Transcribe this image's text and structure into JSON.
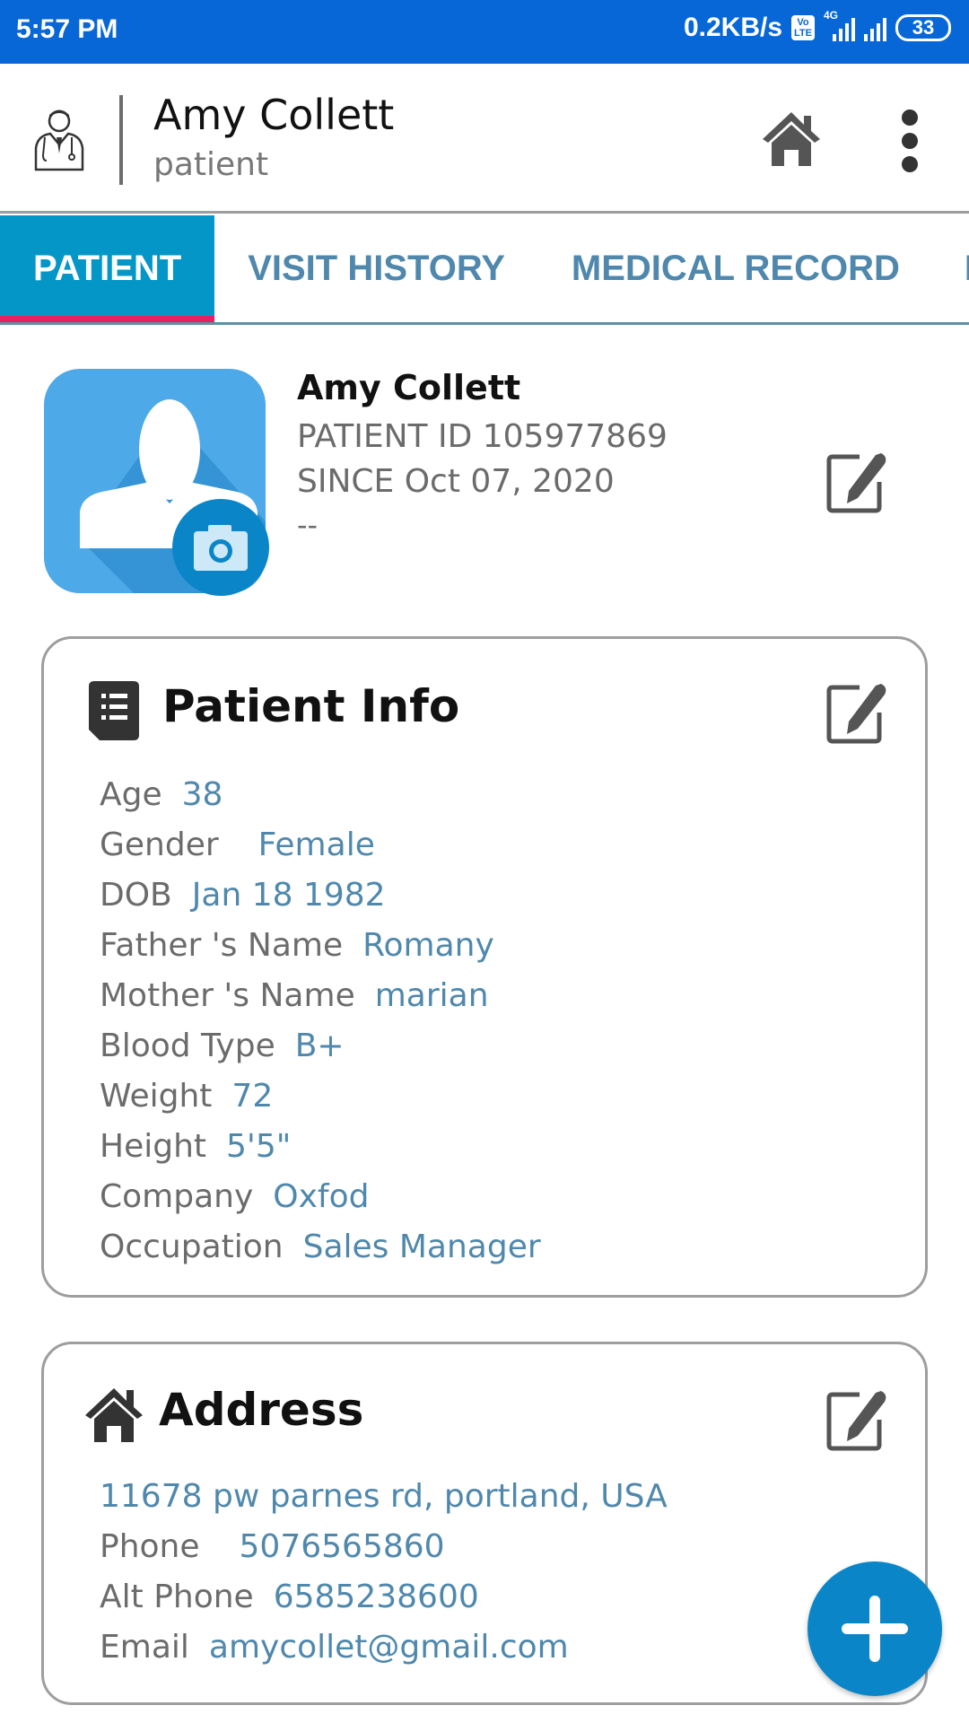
{
  "status_bar": {
    "time": "5:57 PM",
    "net_speed": "0.2KB/s",
    "volte_top": "Vo",
    "volte_bottom": "LTE",
    "network_type": "4G",
    "battery": "33"
  },
  "header": {
    "title": "Amy Collett",
    "subtitle": "patient",
    "icons": [
      "doctor-icon",
      "home-icon",
      "more-vert-icon"
    ]
  },
  "tabs": [
    {
      "label": "PATIENT",
      "active": true
    },
    {
      "label": "VISIT HISTORY",
      "active": false
    },
    {
      "label": "MEDICAL RECORD",
      "active": false
    },
    {
      "label": "M",
      "active": false
    }
  ],
  "profile": {
    "name": "Amy Collett",
    "patient_id": "PATIENT ID 105977869",
    "since": "SINCE Oct 07, 2020",
    "extra": "--"
  },
  "patient_info": {
    "title": "Patient Info",
    "fields": [
      {
        "label": "Age",
        "value": "38"
      },
      {
        "label": "Gender",
        "value": "Female"
      },
      {
        "label": "DOB",
        "value": "Jan 18 1982"
      },
      {
        "label": "Father 's Name",
        "value": "Romany"
      },
      {
        "label": "Mother 's Name",
        "value": "marian"
      },
      {
        "label": "Blood Type",
        "value": "B+"
      },
      {
        "label": "Weight",
        "value": "72"
      },
      {
        "label": "Height",
        "value": "5'5\""
      },
      {
        "label": "Company",
        "value": "Oxfod"
      },
      {
        "label": "Occupation",
        "value": "Sales Manager"
      }
    ]
  },
  "address": {
    "title": "Address",
    "line": "11678 pw parnes rd, portland, USA",
    "fields": [
      {
        "label": "Phone",
        "value": "5076565860"
      },
      {
        "label": "Alt Phone",
        "value": "6585238600"
      },
      {
        "label": "Email",
        "value": "amycollet@gmail.com"
      }
    ]
  },
  "colors": {
    "status_bar": "#0767d6",
    "tab_active_bg": "#0596c8",
    "tab_indicator": "#e91e63",
    "tab_text": "#4f88ac",
    "value_text": "#4f88ac",
    "fab": "#0a86c8"
  }
}
